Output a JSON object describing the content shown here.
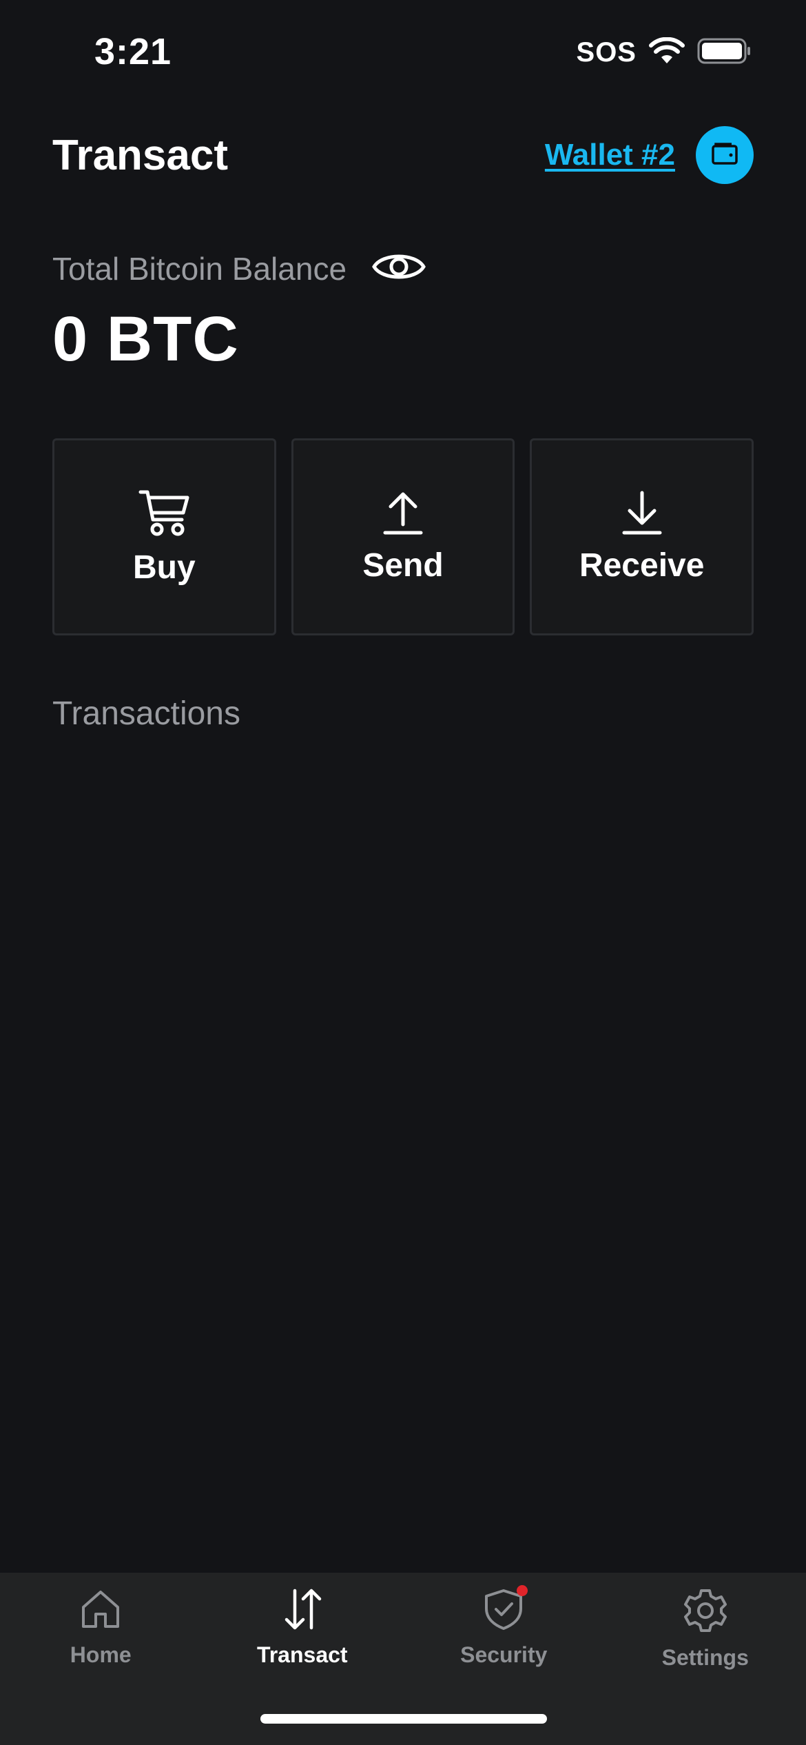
{
  "status_bar": {
    "time": "3:21",
    "carrier": "SOS"
  },
  "header": {
    "title": "Transact",
    "wallet_link": "Wallet #2"
  },
  "balance": {
    "label": "Total Bitcoin Balance",
    "value": "0 BTC"
  },
  "actions": [
    {
      "label": "Buy",
      "icon": "cart-icon"
    },
    {
      "label": "Send",
      "icon": "upload-arrow-icon"
    },
    {
      "label": "Receive",
      "icon": "download-arrow-icon"
    }
  ],
  "transactions": {
    "title": "Transactions"
  },
  "tab_bar": {
    "tabs": [
      {
        "label": "Home",
        "icon": "home-icon",
        "active": false
      },
      {
        "label": "Transact",
        "icon": "swap-arrows-icon",
        "active": true
      },
      {
        "label": "Security",
        "icon": "shield-check-icon",
        "active": false,
        "badge": true
      },
      {
        "label": "Settings",
        "icon": "gear-icon",
        "active": false
      }
    ]
  },
  "colors": {
    "background": "#131417",
    "accent": "#10b9f4",
    "muted_text": "#9a9ca1",
    "tab_bar": "#222324",
    "badge": "#e0242a"
  }
}
